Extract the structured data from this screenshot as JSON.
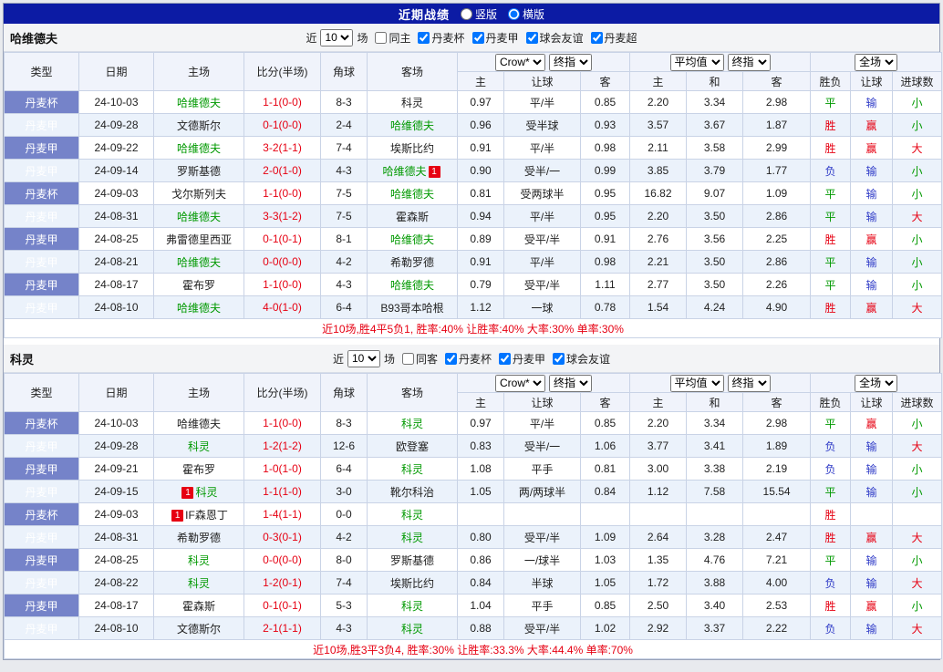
{
  "topbar": {
    "title": "近期战绩",
    "layout_radios": [
      {
        "label": "竖版",
        "checked": false
      },
      {
        "label": "横版",
        "checked": true
      }
    ]
  },
  "table": {
    "headers": {
      "type": "类型",
      "date": "日期",
      "home": "主场",
      "score": "比分(半场)",
      "corner": "角球",
      "away": "客场",
      "odds_home": "主",
      "odds_handicap": "让球",
      "odds_away": "客",
      "avg_home": "主",
      "avg_draw": "和",
      "avg_away": "客",
      "result": "胜负",
      "result_handicap": "让球",
      "result_goals": "进球数"
    },
    "dropdowns": {
      "company": "Crow*",
      "company_final": "终指",
      "average": "平均值",
      "average_final": "终指",
      "fulltime": "全场"
    }
  },
  "colors": {
    "red": "#e60012",
    "blue": "#2f3bc7",
    "green": "#009900",
    "team_green": "#009900",
    "score_red": "#e60012",
    "header_navy": "#0c1ba4",
    "type_column_blue": "#7583c9",
    "row_alt_blue": "#ebf2fb"
  },
  "result_color_map": {
    "胜": "red",
    "负": "blue",
    "平": "green",
    "赢": "red",
    "输": "blue",
    "大": "red",
    "小": "green"
  },
  "sections": [
    {
      "team": "哈维德夫",
      "filter": {
        "prefix": "近",
        "count": "10",
        "suffix": "场",
        "same_side": {
          "label": "同主",
          "checked": false
        },
        "leagues": [
          {
            "label": "丹麦杯",
            "checked": true
          },
          {
            "label": "丹麦甲",
            "checked": true
          },
          {
            "label": "球会友谊",
            "checked": true
          },
          {
            "label": "丹麦超",
            "checked": true
          }
        ]
      },
      "rows": [
        {
          "type": "丹麦杯",
          "date": "24-10-03",
          "home": "哈维德夫",
          "home_focal": true,
          "score": "1-1(0-0)",
          "corner": "8-3",
          "away": "科灵",
          "away_focal": false,
          "odds": [
            "0.97",
            "平/半",
            "0.85"
          ],
          "avg": [
            "2.20",
            "3.34",
            "2.98"
          ],
          "results": [
            "平",
            "输",
            "小"
          ]
        },
        {
          "type": "丹麦甲",
          "date": "24-09-28",
          "home": "文德斯尔",
          "home_focal": false,
          "score": "0-1(0-0)",
          "corner": "2-4",
          "away": "哈维德夫",
          "away_focal": true,
          "odds": [
            "0.96",
            "受半球",
            "0.93"
          ],
          "avg": [
            "3.57",
            "3.67",
            "1.87"
          ],
          "results": [
            "胜",
            "赢",
            "小"
          ]
        },
        {
          "type": "丹麦甲",
          "date": "24-09-22",
          "home": "哈维德夫",
          "home_focal": true,
          "score": "3-2(1-1)",
          "corner": "7-4",
          "away": "埃斯比约",
          "away_focal": false,
          "odds": [
            "0.91",
            "平/半",
            "0.98"
          ],
          "avg": [
            "2.11",
            "3.58",
            "2.99"
          ],
          "results": [
            "胜",
            "赢",
            "大"
          ]
        },
        {
          "type": "丹麦甲",
          "date": "24-09-14",
          "home": "罗斯基德",
          "home_focal": false,
          "score": "2-0(1-0)",
          "corner": "4-3",
          "away": "哈维德夫",
          "away_focal": true,
          "away_badge_post": "1",
          "odds": [
            "0.90",
            "受半/一",
            "0.99"
          ],
          "avg": [
            "3.85",
            "3.79",
            "1.77"
          ],
          "results": [
            "负",
            "输",
            "小"
          ]
        },
        {
          "type": "丹麦杯",
          "date": "24-09-03",
          "home": "戈尔斯列夫",
          "home_focal": false,
          "score": "1-1(0-0)",
          "corner": "7-5",
          "away": "哈维德夫",
          "away_focal": true,
          "odds": [
            "0.81",
            "受两球半",
            "0.95"
          ],
          "avg": [
            "16.82",
            "9.07",
            "1.09"
          ],
          "results": [
            "平",
            "输",
            "小"
          ]
        },
        {
          "type": "丹麦甲",
          "date": "24-08-31",
          "home": "哈维德夫",
          "home_focal": true,
          "score": "3-3(1-2)",
          "corner": "7-5",
          "away": "霍森斯",
          "away_focal": false,
          "odds": [
            "0.94",
            "平/半",
            "0.95"
          ],
          "avg": [
            "2.20",
            "3.50",
            "2.86"
          ],
          "results": [
            "平",
            "输",
            "大"
          ]
        },
        {
          "type": "丹麦甲",
          "date": "24-08-25",
          "home": "弗雷德里西亚",
          "home_focal": false,
          "score": "0-1(0-1)",
          "corner": "8-1",
          "away": "哈维德夫",
          "away_focal": true,
          "odds": [
            "0.89",
            "受平/半",
            "0.91"
          ],
          "avg": [
            "2.76",
            "3.56",
            "2.25"
          ],
          "results": [
            "胜",
            "赢",
            "小"
          ]
        },
        {
          "type": "丹麦甲",
          "date": "24-08-21",
          "home": "哈维德夫",
          "home_focal": true,
          "score": "0-0(0-0)",
          "corner": "4-2",
          "away": "希勒罗德",
          "away_focal": false,
          "odds": [
            "0.91",
            "平/半",
            "0.98"
          ],
          "avg": [
            "2.21",
            "3.50",
            "2.86"
          ],
          "results": [
            "平",
            "输",
            "小"
          ]
        },
        {
          "type": "丹麦甲",
          "date": "24-08-17",
          "home": "霍布罗",
          "home_focal": false,
          "score": "1-1(0-0)",
          "corner": "4-3",
          "away": "哈维德夫",
          "away_focal": true,
          "odds": [
            "0.79",
            "受平/半",
            "1.11"
          ],
          "avg": [
            "2.77",
            "3.50",
            "2.26"
          ],
          "results": [
            "平",
            "输",
            "小"
          ]
        },
        {
          "type": "丹麦甲",
          "date": "24-08-10",
          "home": "哈维德夫",
          "home_focal": true,
          "score": "4-0(1-0)",
          "corner": "6-4",
          "away": "B93哥本哈根",
          "away_focal": false,
          "odds": [
            "1.12",
            "一球",
            "0.78"
          ],
          "avg": [
            "1.54",
            "4.24",
            "4.90"
          ],
          "results": [
            "胜",
            "赢",
            "大"
          ]
        }
      ],
      "summary": "近10场,胜4平5负1, 胜率:40% 让胜率:40% 大率:30% 单率:30%"
    },
    {
      "team": "科灵",
      "filter": {
        "prefix": "近",
        "count": "10",
        "suffix": "场",
        "same_side": {
          "label": "同客",
          "checked": false
        },
        "leagues": [
          {
            "label": "丹麦杯",
            "checked": true
          },
          {
            "label": "丹麦甲",
            "checked": true
          },
          {
            "label": "球会友谊",
            "checked": true
          }
        ]
      },
      "rows": [
        {
          "type": "丹麦杯",
          "date": "24-10-03",
          "home": "哈维德夫",
          "home_focal": false,
          "score": "1-1(0-0)",
          "corner": "8-3",
          "away": "科灵",
          "away_focal": true,
          "odds": [
            "0.97",
            "平/半",
            "0.85"
          ],
          "avg": [
            "2.20",
            "3.34",
            "2.98"
          ],
          "results": [
            "平",
            "赢",
            "小"
          ]
        },
        {
          "type": "丹麦甲",
          "date": "24-09-28",
          "home": "科灵",
          "home_focal": true,
          "score": "1-2(1-2)",
          "corner": "12-6",
          "away": "欧登塞",
          "away_focal": false,
          "odds": [
            "0.83",
            "受半/一",
            "1.06"
          ],
          "avg": [
            "3.77",
            "3.41",
            "1.89"
          ],
          "results": [
            "负",
            "输",
            "大"
          ]
        },
        {
          "type": "丹麦甲",
          "date": "24-09-21",
          "home": "霍布罗",
          "home_focal": false,
          "score": "1-0(1-0)",
          "corner": "6-4",
          "away": "科灵",
          "away_focal": true,
          "odds": [
            "1.08",
            "平手",
            "0.81"
          ],
          "avg": [
            "3.00",
            "3.38",
            "2.19"
          ],
          "results": [
            "负",
            "输",
            "小"
          ]
        },
        {
          "type": "丹麦甲",
          "date": "24-09-15",
          "home": "科灵",
          "home_focal": true,
          "home_badge_pre": "1",
          "score": "1-1(1-0)",
          "corner": "3-0",
          "away": "靴尔科治",
          "away_focal": false,
          "odds": [
            "1.05",
            "两/两球半",
            "0.84"
          ],
          "avg": [
            "1.12",
            "7.58",
            "15.54"
          ],
          "results": [
            "平",
            "输",
            "小"
          ]
        },
        {
          "type": "丹麦杯",
          "date": "24-09-03",
          "home": "IF森恩丁",
          "home_focal": false,
          "home_badge_pre": "1",
          "score": "1-4(1-1)",
          "corner": "0-0",
          "away": "科灵",
          "away_focal": true,
          "odds": [
            "",
            "",
            ""
          ],
          "avg": [
            "",
            "",
            ""
          ],
          "results": [
            "胜",
            "",
            ""
          ]
        },
        {
          "type": "丹麦甲",
          "date": "24-08-31",
          "home": "希勒罗德",
          "home_focal": false,
          "score": "0-3(0-1)",
          "corner": "4-2",
          "away": "科灵",
          "away_focal": true,
          "odds": [
            "0.80",
            "受平/半",
            "1.09"
          ],
          "avg": [
            "2.64",
            "3.28",
            "2.47"
          ],
          "results": [
            "胜",
            "赢",
            "大"
          ]
        },
        {
          "type": "丹麦甲",
          "date": "24-08-25",
          "home": "科灵",
          "home_focal": true,
          "score": "0-0(0-0)",
          "corner": "8-0",
          "away": "罗斯基德",
          "away_focal": false,
          "odds": [
            "0.86",
            "一/球半",
            "1.03"
          ],
          "avg": [
            "1.35",
            "4.76",
            "7.21"
          ],
          "results": [
            "平",
            "输",
            "小"
          ]
        },
        {
          "type": "丹麦甲",
          "date": "24-08-22",
          "home": "科灵",
          "home_focal": true,
          "score": "1-2(0-1)",
          "corner": "7-4",
          "away": "埃斯比约",
          "away_focal": false,
          "odds": [
            "0.84",
            "半球",
            "1.05"
          ],
          "avg": [
            "1.72",
            "3.88",
            "4.00"
          ],
          "results": [
            "负",
            "输",
            "大"
          ]
        },
        {
          "type": "丹麦甲",
          "date": "24-08-17",
          "home": "霍森斯",
          "home_focal": false,
          "score": "0-1(0-1)",
          "corner": "5-3",
          "away": "科灵",
          "away_focal": true,
          "odds": [
            "1.04",
            "平手",
            "0.85"
          ],
          "avg": [
            "2.50",
            "3.40",
            "2.53"
          ],
          "results": [
            "胜",
            "赢",
            "小"
          ]
        },
        {
          "type": "丹麦甲",
          "date": "24-08-10",
          "home": "文德斯尔",
          "home_focal": false,
          "score": "2-1(1-1)",
          "corner": "4-3",
          "away": "科灵",
          "away_focal": true,
          "odds": [
            "0.88",
            "受平/半",
            "1.02"
          ],
          "avg": [
            "2.92",
            "3.37",
            "2.22"
          ],
          "results": [
            "负",
            "输",
            "大"
          ]
        }
      ],
      "summary": "近10场,胜3平3负4, 胜率:30% 让胜率:33.3% 大率:44.4% 单率:70%"
    }
  ]
}
